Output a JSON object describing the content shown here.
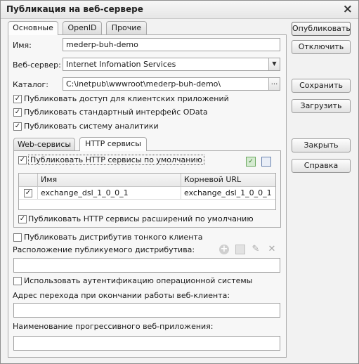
{
  "window": {
    "title": "Публикация на веб-сервере"
  },
  "tabs": [
    "Основные",
    "OpenID",
    "Прочие"
  ],
  "form": {
    "name_label": "Имя:",
    "name_value": "mederp-buh-demo",
    "webserver_label": "Веб-сервер:",
    "webserver_value": "Internet Infomation Services",
    "catalog_label": "Каталог:",
    "catalog_value": "C:\\inetpub\\wwwroot\\mederp-buh-demo\\",
    "catalog_button": "...",
    "chk_client_apps": "Публиковать доступ для клиентских приложений",
    "chk_odata": "Публиковать стандартный интерфейс OData",
    "chk_analytics": "Публиковать систему аналитики"
  },
  "inner_tabs": [
    "Web-сервисы",
    "HTTP сервисы"
  ],
  "http": {
    "chk_default": "Публиковать HTTP сервисы по умолчанию",
    "columns": [
      "Имя",
      "Корневой URL"
    ],
    "rows": [
      {
        "checked": true,
        "name": "exchange_dsl_1_0_0_1",
        "url": "exchange_dsl_1_0_0_1"
      }
    ],
    "chk_extensions": "Публиковать HTTP сервисы расширений по умолчанию"
  },
  "thin_client": {
    "chk_distrib": "Публиковать дистрибутив тонкого клиента",
    "location_label": "Расположение публикуемого дистрибутива:",
    "location_value": ""
  },
  "auth": {
    "chk_os_auth": "Использовать аутентификацию операционной системы",
    "exit_url_label": "Адрес перехода при окончании работы веб-клиента:",
    "exit_url_value": "",
    "pwa_label": "Наименование прогрессивного веб-приложения:",
    "pwa_value": ""
  },
  "buttons": {
    "publish": "Опубликовать",
    "disable": "Отключить",
    "save": "Сохранить",
    "load": "Загрузить",
    "close": "Закрыть",
    "help": "Справка"
  },
  "icons": {
    "close": "×",
    "dropdown": "▼",
    "check": "✓",
    "add": "+",
    "edit": "✎",
    "delete": "✕"
  }
}
